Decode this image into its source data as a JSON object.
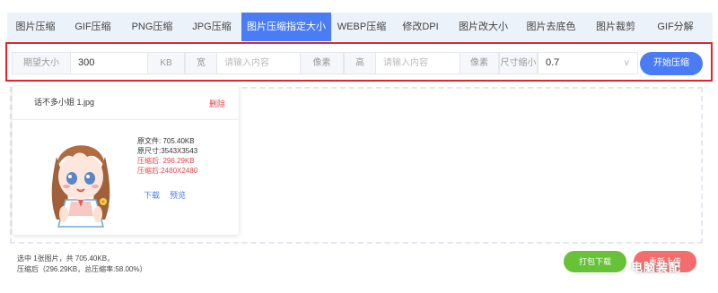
{
  "tabs": [
    {
      "label": "图片压缩",
      "active": false
    },
    {
      "label": "GIF压缩",
      "active": false
    },
    {
      "label": "PNG压缩",
      "active": false
    },
    {
      "label": "JPG压缩",
      "active": false
    },
    {
      "label": "图片压缩指定大小",
      "active": true
    },
    {
      "label": "WEBP压缩",
      "active": false
    },
    {
      "label": "修改DPI",
      "active": false
    },
    {
      "label": "图片改大小",
      "active": false
    },
    {
      "label": "图片去底色",
      "active": false
    },
    {
      "label": "图片裁剪",
      "active": false
    },
    {
      "label": "GIF分解",
      "active": false
    }
  ],
  "options": {
    "expected_size_label": "期望大小",
    "expected_size_value": "300",
    "unit_kb": "KB",
    "width_label": "宽",
    "width_placeholder": "请输入内容",
    "pixel_unit_1": "像素",
    "height_label": "高",
    "height_placeholder": "请输入内容",
    "pixel_unit_2": "像素",
    "scale_label": "尺寸缩小",
    "scale_value": "0.7",
    "start_button": "开始压缩"
  },
  "card": {
    "file_name": "话不多小姐 1.jpg",
    "delete": "删除",
    "original_file": "原文件: 705.40KB",
    "original_size": "原尺寸:3543X3543",
    "compressed_file": "压缩后: 296.29KB",
    "compressed_size": "压缩后:2480X2480",
    "download": "下载",
    "preview": "预览"
  },
  "footer": {
    "summary_line1": "选中 1张图片，共 705.40KB，",
    "summary_line2": "压缩后（296.29KB，总压缩率:58.00%）",
    "pack_download": "打包下载",
    "reupload": "重新上传",
    "watermark": "电脑装配"
  },
  "colors": {
    "accent": "#4a7cf5",
    "highlight_border": "#e0262a",
    "delete_red": "#e0474b",
    "green": "#67c23a",
    "red_button": "#f56c6c",
    "tab_bg": "#ecf2f9"
  }
}
